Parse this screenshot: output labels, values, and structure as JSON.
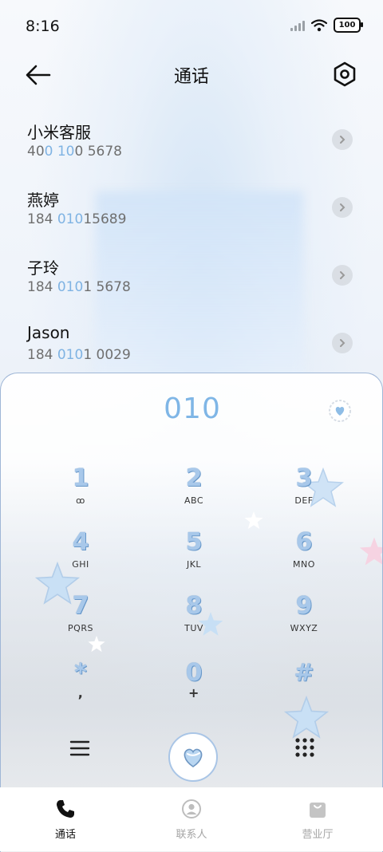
{
  "status_bar": {
    "time": "8:16",
    "battery": "100"
  },
  "header": {
    "title": "通话"
  },
  "contacts": [
    {
      "name": "小米客服",
      "number_parts": [
        "40",
        "0 10",
        "0 5678"
      ]
    },
    {
      "name": "燕婷",
      "number_parts": [
        "184 ",
        "010",
        "15689"
      ]
    },
    {
      "name": "子玲",
      "number_parts": [
        "184 ",
        "010",
        "1 5678"
      ]
    },
    {
      "name": "Jason",
      "number_parts": [
        "184 ",
        "010",
        "1 0029"
      ]
    }
  ],
  "dialpad": {
    "input": "010",
    "keys": [
      {
        "digit": "1",
        "letters": "ꝏ"
      },
      {
        "digit": "2",
        "letters": "ABC"
      },
      {
        "digit": "3",
        "letters": "DEF"
      },
      {
        "digit": "4",
        "letters": "GHI"
      },
      {
        "digit": "5",
        "letters": "JKL"
      },
      {
        "digit": "6",
        "letters": "MNO"
      },
      {
        "digit": "7",
        "letters": "PQRS"
      },
      {
        "digit": "8",
        "letters": "TUV"
      },
      {
        "digit": "9",
        "letters": "WXYZ"
      },
      {
        "digit": "*",
        "letters": ","
      },
      {
        "digit": "0",
        "letters": "+"
      },
      {
        "digit": "#",
        "letters": ""
      }
    ]
  },
  "bottom_nav": [
    {
      "label": "通话",
      "active": true
    },
    {
      "label": "联系人",
      "active": false
    },
    {
      "label": "营业厅",
      "active": false
    }
  ],
  "colors": {
    "accent": "#7fb6e6",
    "active_tab": "#111111",
    "inactive_tab": "#a5a5a5"
  }
}
